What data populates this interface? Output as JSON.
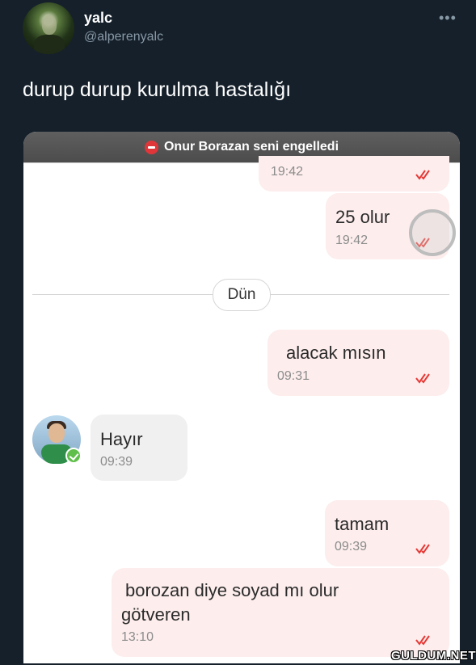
{
  "tweet": {
    "display_name": "yalc",
    "handle": "@alperenyalc",
    "more_icon": "more-horizontal-icon",
    "text": "durup durup kurulma hastalığı"
  },
  "chat": {
    "blocked_banner": "Onur Borazan seni engelledi",
    "block_icon": "no-entry-icon",
    "date_divider": "Dün",
    "messages": [
      {
        "direction": "out",
        "text": "",
        "time": "19:42",
        "status": "read-ticks-icon"
      },
      {
        "direction": "out",
        "text": "25 olur",
        "time": "19:42",
        "status": "read-ticks-icon"
      },
      {
        "direction": "out",
        "text": "alacak mısın",
        "time": "09:31",
        "status": "read-ticks-icon"
      },
      {
        "direction": "in",
        "text": "Hayır",
        "time": "09:39"
      },
      {
        "direction": "out",
        "text": "tamam",
        "time": "09:39",
        "status": "read-ticks-icon"
      },
      {
        "direction": "out",
        "text_lines": [
          "borozan diye soyad mı olur",
          "götveren"
        ],
        "time": "13:10",
        "status": "read-ticks-icon"
      }
    ]
  },
  "watermark": "GULDUM.NET",
  "colors": {
    "background": "#15202b",
    "outgoing_bubble": "#fdeded",
    "incoming_bubble": "#f0f0f0",
    "tick_red": "#e53935",
    "blocked_icon": "#e0363a"
  }
}
